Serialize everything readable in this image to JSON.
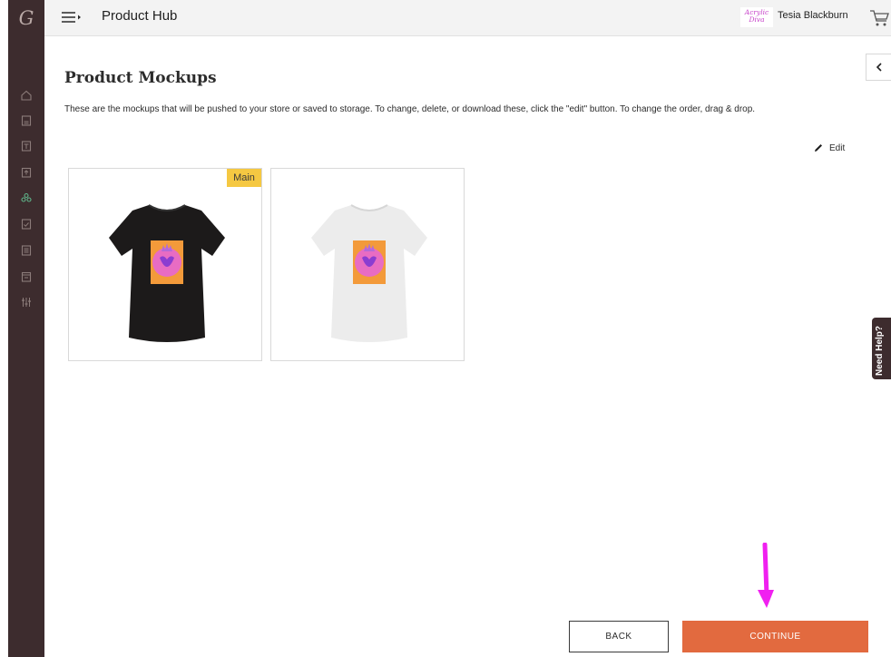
{
  "app": {
    "logo_glyph": "G",
    "title": "Product Hub"
  },
  "header": {
    "brand_logo_line1": "Acrylic",
    "brand_logo_line2": "Diva",
    "user_name": "Tesia Blackburn"
  },
  "sidebar": {
    "icons": [
      "home-icon",
      "store-icon",
      "product-icon",
      "upload-icon",
      "design-icon",
      "checklist-icon",
      "orders-icon",
      "calendar-icon",
      "settings-sliders-icon"
    ]
  },
  "main": {
    "title": "Product Mockups",
    "description": "These are the mockups that will be pushed to your store or saved to storage. To change, delete, or download these, click the \"edit\" button. To change the order, drag & drop.",
    "edit_label": "Edit",
    "mockups": [
      {
        "badge": "Main",
        "shirt_color": "#1c1a1a"
      },
      {
        "badge": "",
        "shirt_color": "#ececec"
      }
    ]
  },
  "help": {
    "label": "Need Help?"
  },
  "actions": {
    "back_label": "BACK",
    "continue_label": "CONTINUE"
  },
  "colors": {
    "rail": "#3d2c2e",
    "accent": "#e26a3f",
    "badge": "#f5c842",
    "annotation_arrow": "#f020f0"
  }
}
